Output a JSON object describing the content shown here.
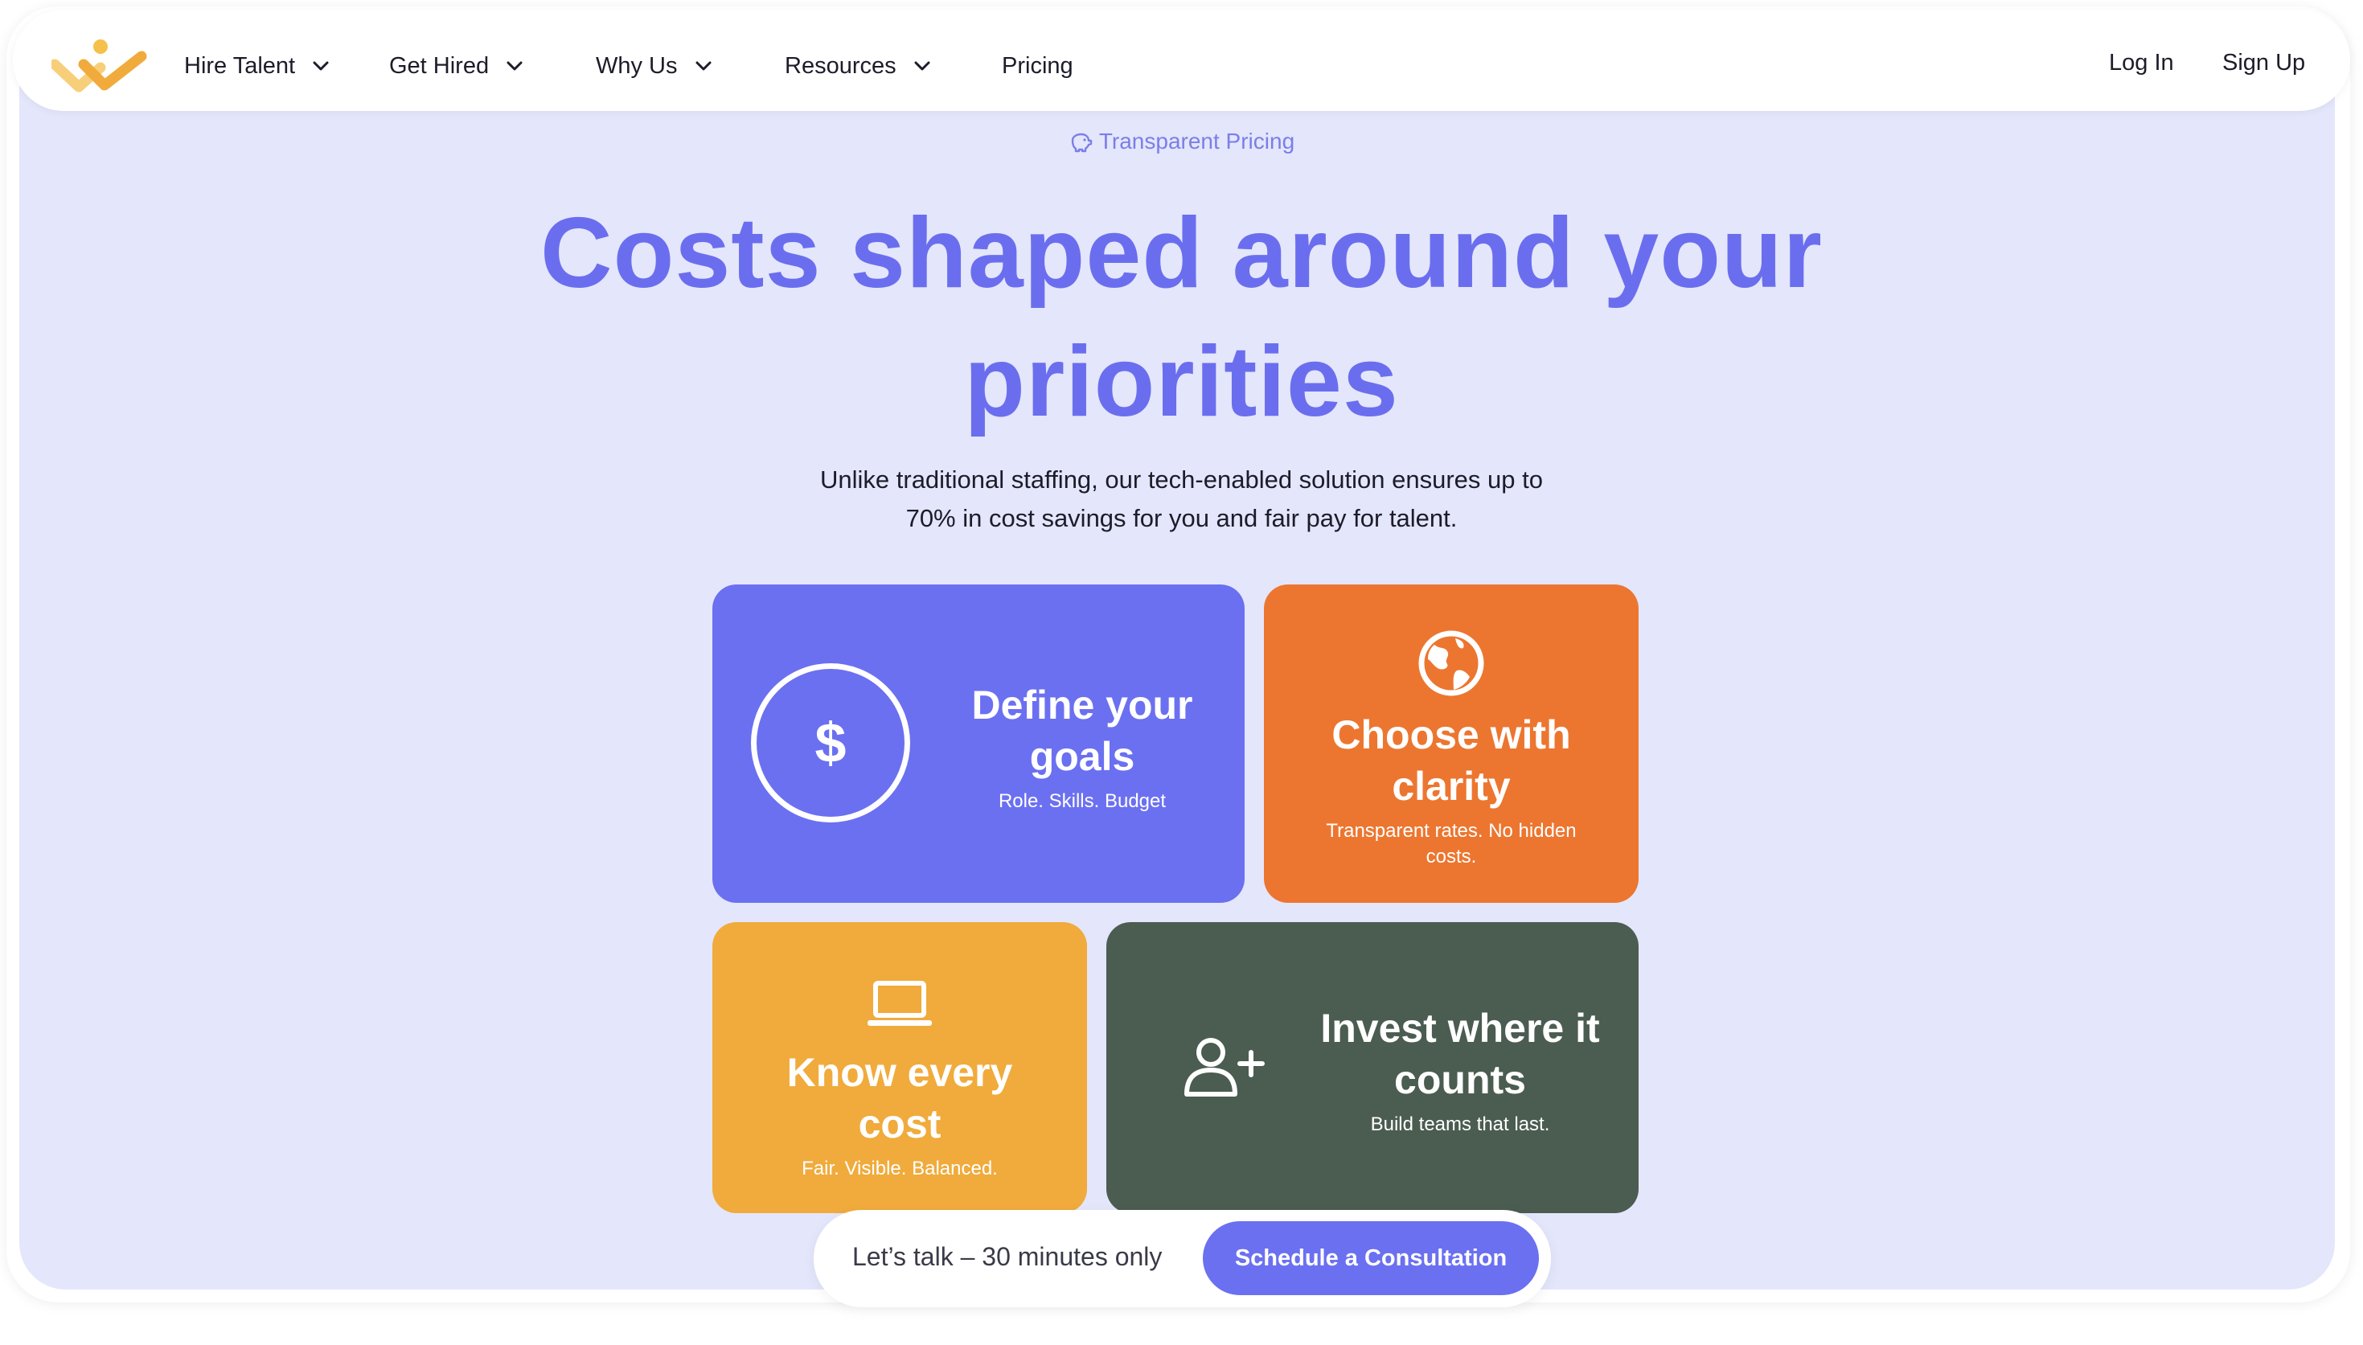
{
  "nav": {
    "items": [
      {
        "label": "Hire Talent",
        "dropdown": true
      },
      {
        "label": "Get Hired",
        "dropdown": true
      },
      {
        "label": "Why Us",
        "dropdown": true
      },
      {
        "label": "Resources",
        "dropdown": true
      },
      {
        "label": "Pricing",
        "dropdown": false
      }
    ],
    "login_label": "Log In",
    "signup_label": "Sign Up"
  },
  "hero": {
    "badge": "Transparent Pricing",
    "headline_line1": "Costs shaped around your",
    "headline_line2": "priorities",
    "subtext_line1": "Unlike traditional staffing, our tech-enabled solution ensures up to",
    "subtext_line2": "70% in cost savings for you and fair pay for talent."
  },
  "cards": {
    "goals": {
      "title_line1": "Define your",
      "title_line2": "goals",
      "subtitle": "Role. Skills. Budget",
      "icon": "dollar-icon",
      "color": "#6b70f1"
    },
    "clarity": {
      "title_line1": "Choose with",
      "title_line2": "clarity",
      "subtitle_line1": "Transparent rates. No hidden",
      "subtitle_line2": "costs.",
      "icon": "globe-icon",
      "color": "#ec7630"
    },
    "cost": {
      "title_line1": "Know every",
      "title_line2": "cost",
      "subtitle": "Fair. Visible. Balanced.",
      "icon": "laptop-icon",
      "color": "#f0ab3c"
    },
    "invest": {
      "title_line1": "Invest where it",
      "title_line2": "counts",
      "subtitle": "Build teams that last.",
      "icon": "user-plus-icon",
      "color": "#4b5c51"
    }
  },
  "cta": {
    "text": "Let’s talk – 30 minutes only",
    "button_label": "Schedule a Consultation"
  },
  "colors": {
    "accent": "#6b70f1",
    "hero_bg": "#e4e6fb",
    "logo_gold": "#f0ab3c"
  }
}
